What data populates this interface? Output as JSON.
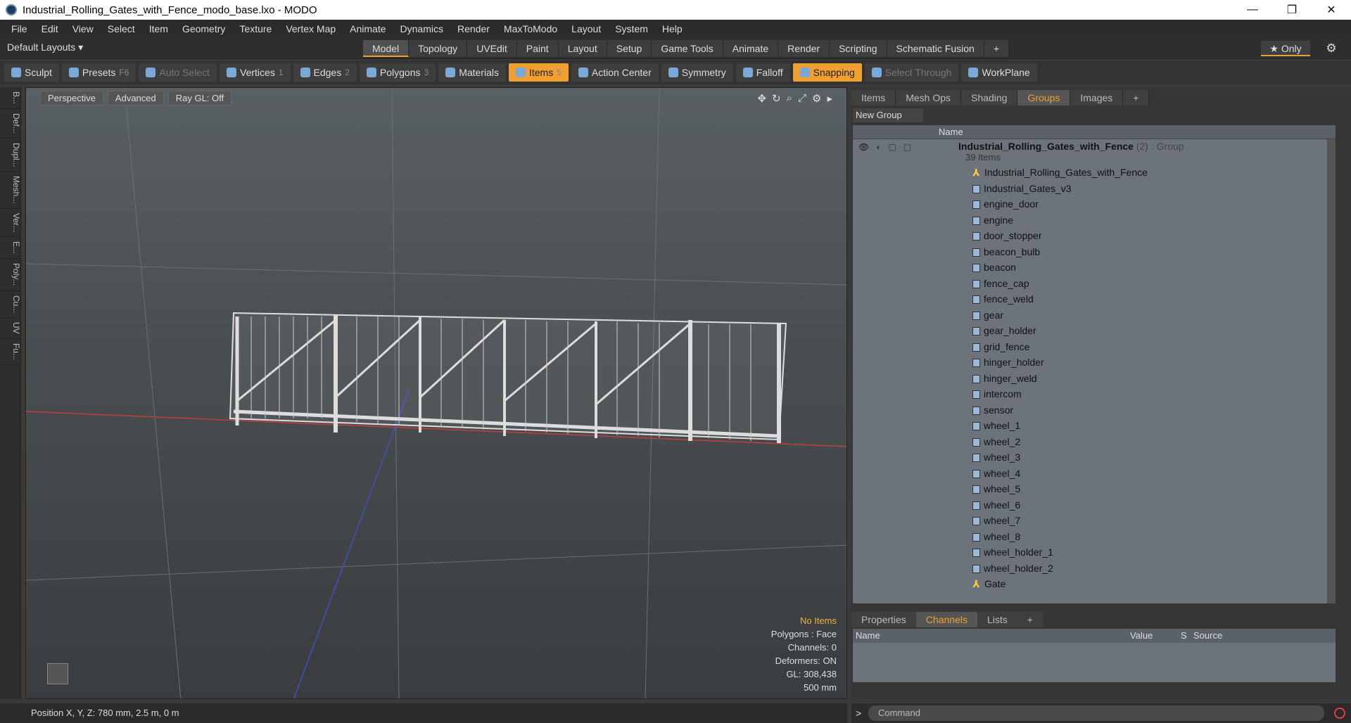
{
  "window": {
    "title": "Industrial_Rolling_Gates_with_Fence_modo_base.lxo - MODO"
  },
  "menu": [
    "File",
    "Edit",
    "View",
    "Select",
    "Item",
    "Geometry",
    "Texture",
    "Vertex Map",
    "Animate",
    "Dynamics",
    "Render",
    "MaxToModo",
    "Layout",
    "System",
    "Help"
  ],
  "layout": {
    "default": "Default Layouts ▾",
    "tabs": [
      "Model",
      "Topology",
      "UVEdit",
      "Paint",
      "Layout",
      "Setup",
      "Game Tools",
      "Animate",
      "Render",
      "Scripting",
      "Schematic Fusion",
      "+"
    ],
    "only": "★ Only"
  },
  "toolbar": [
    {
      "label": "Sculpt",
      "key": ""
    },
    {
      "label": "Presets",
      "key": "F6"
    },
    {
      "label": "Auto Select",
      "key": "",
      "dim": true
    },
    {
      "label": "Vertices",
      "key": "1"
    },
    {
      "label": "Edges",
      "key": "2"
    },
    {
      "label": "Polygons",
      "key": "3"
    },
    {
      "label": "Materials",
      "key": ""
    },
    {
      "label": "Items",
      "key": "5",
      "active": true
    },
    {
      "label": "Action Center",
      "key": ""
    },
    {
      "label": "Symmetry",
      "key": ""
    },
    {
      "label": "Falloff",
      "key": ""
    },
    {
      "label": "Snapping",
      "key": "",
      "active": true
    },
    {
      "label": "Select Through",
      "key": "",
      "dim": true
    },
    {
      "label": "WorkPlane",
      "key": ""
    }
  ],
  "leftstrip": [
    "B...",
    "Def...",
    "Dupl...",
    "Mesh...",
    "Ver...",
    "E...",
    "Poly...",
    "Cu...",
    "UV",
    "Fu..."
  ],
  "viewport": {
    "view": "Perspective",
    "shading": "Advanced",
    "raygl": "Ray GL: Off",
    "info": {
      "items": "No Items",
      "polygons": "Polygons : Face",
      "channels": "Channels: 0",
      "deformers": "Deformers: ON",
      "gl": "GL: 308,438",
      "scale": "500 mm"
    }
  },
  "status": {
    "position": "Position X, Y, Z:   780 mm, 2.5 m, 0 m"
  },
  "rpanel": {
    "tabs": [
      "Items",
      "Mesh Ops",
      "Shading",
      "Groups",
      "Images",
      "+"
    ],
    "new_group": "New Group",
    "name_header": "Name",
    "group": {
      "name": "Industrial_Rolling_Gates_with_Fence",
      "count": "(2)",
      "type": ": Group",
      "items": "39 Items"
    },
    "rows": [
      {
        "name": "Industrial_Rolling_Gates_with_Fence",
        "loc": true
      },
      {
        "name": "Industrial_Gates_v3"
      },
      {
        "name": "engine_door"
      },
      {
        "name": "engine"
      },
      {
        "name": "door_stopper"
      },
      {
        "name": "beacon_bulb"
      },
      {
        "name": "beacon"
      },
      {
        "name": "fence_cap"
      },
      {
        "name": "fence_weld"
      },
      {
        "name": "gear"
      },
      {
        "name": "gear_holder"
      },
      {
        "name": "grid_fence"
      },
      {
        "name": "hinger_holder"
      },
      {
        "name": "hinger_weld"
      },
      {
        "name": "intercom"
      },
      {
        "name": "sensor"
      },
      {
        "name": "wheel_1"
      },
      {
        "name": "wheel_2"
      },
      {
        "name": "wheel_3"
      },
      {
        "name": "wheel_4"
      },
      {
        "name": "wheel_5"
      },
      {
        "name": "wheel_6"
      },
      {
        "name": "wheel_7"
      },
      {
        "name": "wheel_8"
      },
      {
        "name": "wheel_holder_1"
      },
      {
        "name": "wheel_holder_2"
      },
      {
        "name": "Gate",
        "loc": true
      }
    ],
    "btabs": [
      "Properties",
      "Channels",
      "Lists",
      "+"
    ],
    "channels": {
      "name": "Name",
      "value": "Value",
      "s": "S",
      "source": "Source"
    }
  },
  "command": {
    "placeholder": "Command"
  }
}
